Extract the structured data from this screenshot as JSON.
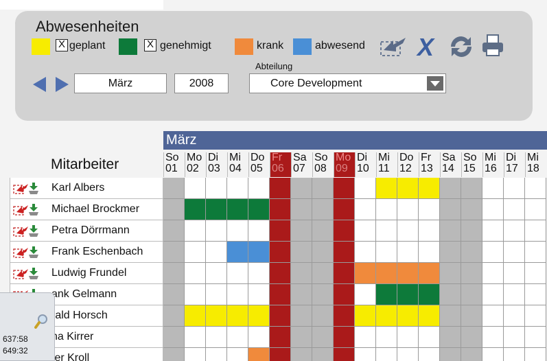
{
  "header": {
    "title": "Abwesenheiten",
    "legend": [
      {
        "label": "geplant",
        "color": "#f7ec00",
        "checkbox": true,
        "checked": true
      },
      {
        "label": "genehmigt",
        "color": "#0d7a3a",
        "checkbox": true,
        "checked": true
      },
      {
        "label": "krank",
        "color": "#f08a3c",
        "checkbox": false
      },
      {
        "label": "abwesend",
        "color": "#4a8fd6",
        "checkbox": false
      }
    ],
    "checkbox_mark": "X",
    "toolbar": [
      "export-icon",
      "delete-x-icon",
      "refresh-icon",
      "print-icon"
    ]
  },
  "filters": {
    "month": "März",
    "year": "2008",
    "department_label": "Abteilung",
    "department": "Core Development"
  },
  "calendar": {
    "month_label": "März",
    "employees_header": "Mitarbeiter",
    "colors": {
      "weekend": "#b9b9b9",
      "holiday": "#aa1a1a",
      "empty": "#ffffff",
      "geplant": "#f7ec00",
      "genehmigt": "#0d7a3a",
      "krank": "#f08a3c",
      "abwesend": "#4a8fd6"
    },
    "days": [
      {
        "wd": "So",
        "d": "01",
        "kind": "weekend"
      },
      {
        "wd": "Mo",
        "d": "02",
        "kind": "work"
      },
      {
        "wd": "Di",
        "d": "03",
        "kind": "work"
      },
      {
        "wd": "Mi",
        "d": "04",
        "kind": "work"
      },
      {
        "wd": "Do",
        "d": "05",
        "kind": "work"
      },
      {
        "wd": "Fr",
        "d": "06",
        "kind": "holiday"
      },
      {
        "wd": "Sa",
        "d": "07",
        "kind": "weekend"
      },
      {
        "wd": "So",
        "d": "08",
        "kind": "weekend"
      },
      {
        "wd": "Mo",
        "d": "09",
        "kind": "holiday"
      },
      {
        "wd": "Di",
        "d": "10",
        "kind": "work"
      },
      {
        "wd": "Mi",
        "d": "11",
        "kind": "work"
      },
      {
        "wd": "Do",
        "d": "12",
        "kind": "work"
      },
      {
        "wd": "Fr",
        "d": "13",
        "kind": "work"
      },
      {
        "wd": "Sa",
        "d": "14",
        "kind": "weekend"
      },
      {
        "wd": "So",
        "d": "15",
        "kind": "weekend"
      },
      {
        "wd": "Mi",
        "d": "16",
        "kind": "work"
      },
      {
        "wd": "Di",
        "d": "17",
        "kind": "work"
      },
      {
        "wd": "Mi",
        "d": "18",
        "kind": "work"
      }
    ],
    "employees": [
      {
        "name": "Karl Albers",
        "absences": {
          "11": "geplant",
          "12": "geplant",
          "13": "geplant"
        }
      },
      {
        "name": "Michael Brockmer",
        "absences": {
          "02": "genehmigt",
          "03": "genehmigt",
          "04": "genehmigt",
          "05": "genehmigt"
        }
      },
      {
        "name": "Petra Dörrmann",
        "absences": {}
      },
      {
        "name": "Frank Eschenbach",
        "absences": {
          "04": "abwesend",
          "05": "abwesend"
        }
      },
      {
        "name": "Ludwig Frundel",
        "absences": {
          "10": "krank",
          "11": "krank",
          "12": "krank",
          "13": "krank"
        }
      },
      {
        "name": "ank Gelmann",
        "absences": {
          "11": "genehmigt",
          "12": "genehmigt",
          "13": "genehmigt"
        }
      },
      {
        "name": "rald Horsch",
        "absences": {
          "02": "geplant",
          "03": "geplant",
          "04": "geplant",
          "05": "geplant",
          "10": "geplant",
          "11": "geplant",
          "12": "geplant",
          "13": "geplant"
        }
      },
      {
        "name": "na Kirrer",
        "absences": {}
      },
      {
        "name": "ter Kroll",
        "absences": {
          "05": "krank"
        }
      }
    ]
  },
  "popup": {
    "icon": "magnifier-icon",
    "line1": "637:58",
    "line2": "649:32"
  }
}
